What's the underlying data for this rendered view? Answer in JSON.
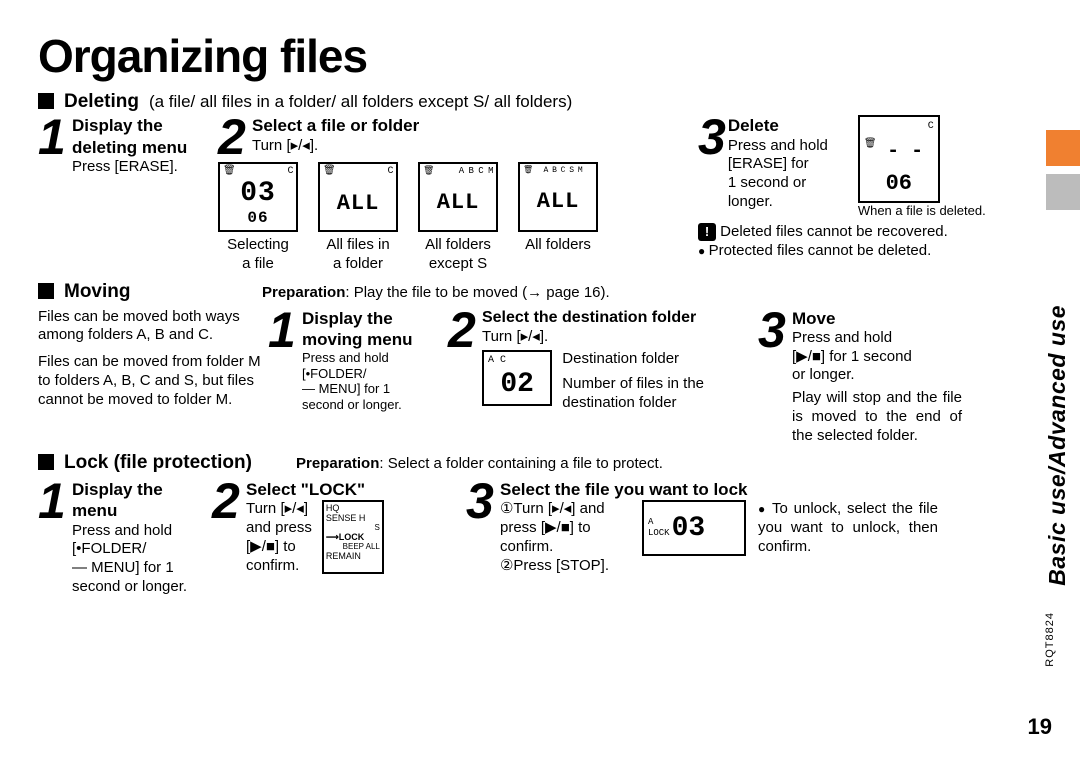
{
  "title": "Organizing files",
  "deleting": {
    "header": "Deleting",
    "scope": "(a file/ all files in a folder/ all folders except S/ all folders)",
    "step1": {
      "title": "Display the deleting menu",
      "sub": "Press [ERASE]."
    },
    "step2": {
      "title": "Select a file or folder",
      "sub": "Turn [▸/◂].",
      "lcds": [
        {
          "top": "C",
          "mid": "03",
          "bot": "06",
          "cap_l1": "Selecting",
          "cap_l2": "a file"
        },
        {
          "top": "C",
          "mid": "ALL",
          "bot": "",
          "cap_l1": "All files in",
          "cap_l2": "a folder"
        },
        {
          "top": "A B C M",
          "mid": "ALL",
          "bot": "",
          "cap_l1": "All folders",
          "cap_l2": "except  S"
        },
        {
          "top": "A B C S M",
          "mid": "ALL",
          "bot": "",
          "cap_l1": "All folders",
          "cap_l2": ""
        }
      ]
    },
    "step3": {
      "title": "Delete",
      "sub1": "Press and hold",
      "sub2": "[ERASE] for",
      "sub3": "1 second or",
      "sub4": "longer.",
      "lcd": {
        "top": "C",
        "mid": "- -",
        "bot": "06"
      },
      "cap": "When a file is deleted.",
      "warn": "Deleted files cannot be recovered.",
      "note": "Protected files cannot be deleted."
    }
  },
  "moving": {
    "header": "Moving",
    "prep_label": "Preparation",
    "prep_text": ": Play the file to be moved (→ page 16).",
    "intro1": "Files can be moved both ways among folders A, B and C.",
    "intro2": "Files can be moved from folder M to folders A, B, C and S, but files cannot be moved to folder M.",
    "step1": {
      "title": "Display the moving menu",
      "sub1": "Press and hold",
      "sub2": "[•FOLDER/",
      "sub3": "— MENU] for 1",
      "sub4": "second or longer."
    },
    "step2": {
      "title": "Select the destination folder",
      "sub": "Turn [▸/◂].",
      "lcd": {
        "top": "A  C",
        "mid": "02"
      },
      "label1": "Destination folder",
      "label2": "Number of files in the destination folder"
    },
    "step3": {
      "title": "Move",
      "sub1": "Press and hold",
      "sub2": "[▶/■] for 1 second",
      "sub3": "or longer.",
      "note": "Play will stop and the file is moved to the end of the selected folder."
    }
  },
  "lock": {
    "header": "Lock (file protection)",
    "prep_label": "Preparation",
    "prep_text": ": Select a folder containing a file to protect.",
    "step1": {
      "title": "Display the menu",
      "sub1": "Press and hold",
      "sub2": "[•FOLDER/",
      "sub3": "— MENU] for 1",
      "sub4": "second or longer."
    },
    "step2": {
      "title": "Select \"LOCK\"",
      "sub1": "Turn [▸/◂]",
      "sub2": "and press",
      "sub3": "[▶/■] to",
      "sub4": "confirm.",
      "lcd_lines": [
        "HQ",
        "SENSE H",
        "S",
        "LOCK",
        "BEEP  ALL",
        "REMAIN"
      ]
    },
    "step3": {
      "title": "Select the file you want to lock",
      "sub1": "①Turn [▸/◂] and",
      "sub2": "press [▶/■] to",
      "sub3": "confirm.",
      "sub4": "②Press [STOP].",
      "lcd": {
        "top": "A",
        "label": "LOCK",
        "mid": "03"
      },
      "note": "To unlock, select the file you want to unlock, then confirm."
    }
  },
  "side_label": "Basic use/Advanced use",
  "side_code": "RQT8824",
  "page_num": "19"
}
